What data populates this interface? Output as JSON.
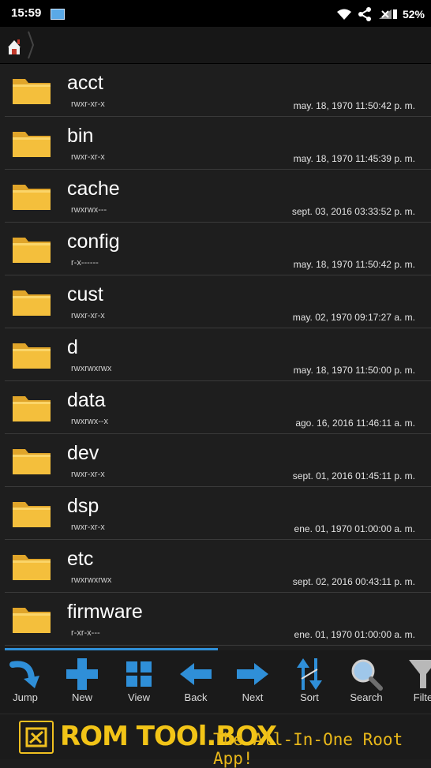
{
  "status_bar": {
    "time": "15:59",
    "battery": "52%"
  },
  "path_bar": {
    "home_icon": "home-icon"
  },
  "files": [
    {
      "name": "acct",
      "permissions": "rwxr-xr-x",
      "modified": "may. 18, 1970 11:50:42 p. m."
    },
    {
      "name": "bin",
      "permissions": "rwxr-xr-x",
      "modified": "may. 18, 1970 11:45:39 p. m."
    },
    {
      "name": "cache",
      "permissions": "rwxrwx---",
      "modified": "sept. 03, 2016 03:33:52 p. m."
    },
    {
      "name": "config",
      "permissions": "r-x------",
      "modified": "may. 18, 1970 11:50:42 p. m."
    },
    {
      "name": "cust",
      "permissions": "rwxr-xr-x",
      "modified": "may. 02, 1970 09:17:27 a. m."
    },
    {
      "name": "d",
      "permissions": "rwxrwxrwx",
      "modified": "may. 18, 1970 11:50:00 p. m."
    },
    {
      "name": "data",
      "permissions": "rwxrwx--x",
      "modified": "ago. 16, 2016 11:46:11 a. m."
    },
    {
      "name": "dev",
      "permissions": "rwxr-xr-x",
      "modified": "sept. 01, 2016 01:45:11 p. m."
    },
    {
      "name": "dsp",
      "permissions": "rwxr-xr-x",
      "modified": "ene. 01, 1970 01:00:00 a. m."
    },
    {
      "name": "etc",
      "permissions": "rwxrwxrwx",
      "modified": "sept. 02, 2016 00:43:11 p. m."
    },
    {
      "name": "firmware",
      "permissions": "r-xr-x---",
      "modified": "ene. 01, 1970 01:00:00 a. m."
    }
  ],
  "toolbar": {
    "jump": "Jump",
    "new": "New",
    "view": "View",
    "back": "Back",
    "next": "Next",
    "sort": "Sort",
    "search": "Search",
    "filter": "Filte"
  },
  "banner": {
    "brand": "ROM TOOl.BOX",
    "tagline": "The All-In-One Root App!"
  },
  "colors": {
    "folder": "#f4bf3c",
    "accent": "#2f8fd8",
    "banner_text": "#f2c417"
  }
}
